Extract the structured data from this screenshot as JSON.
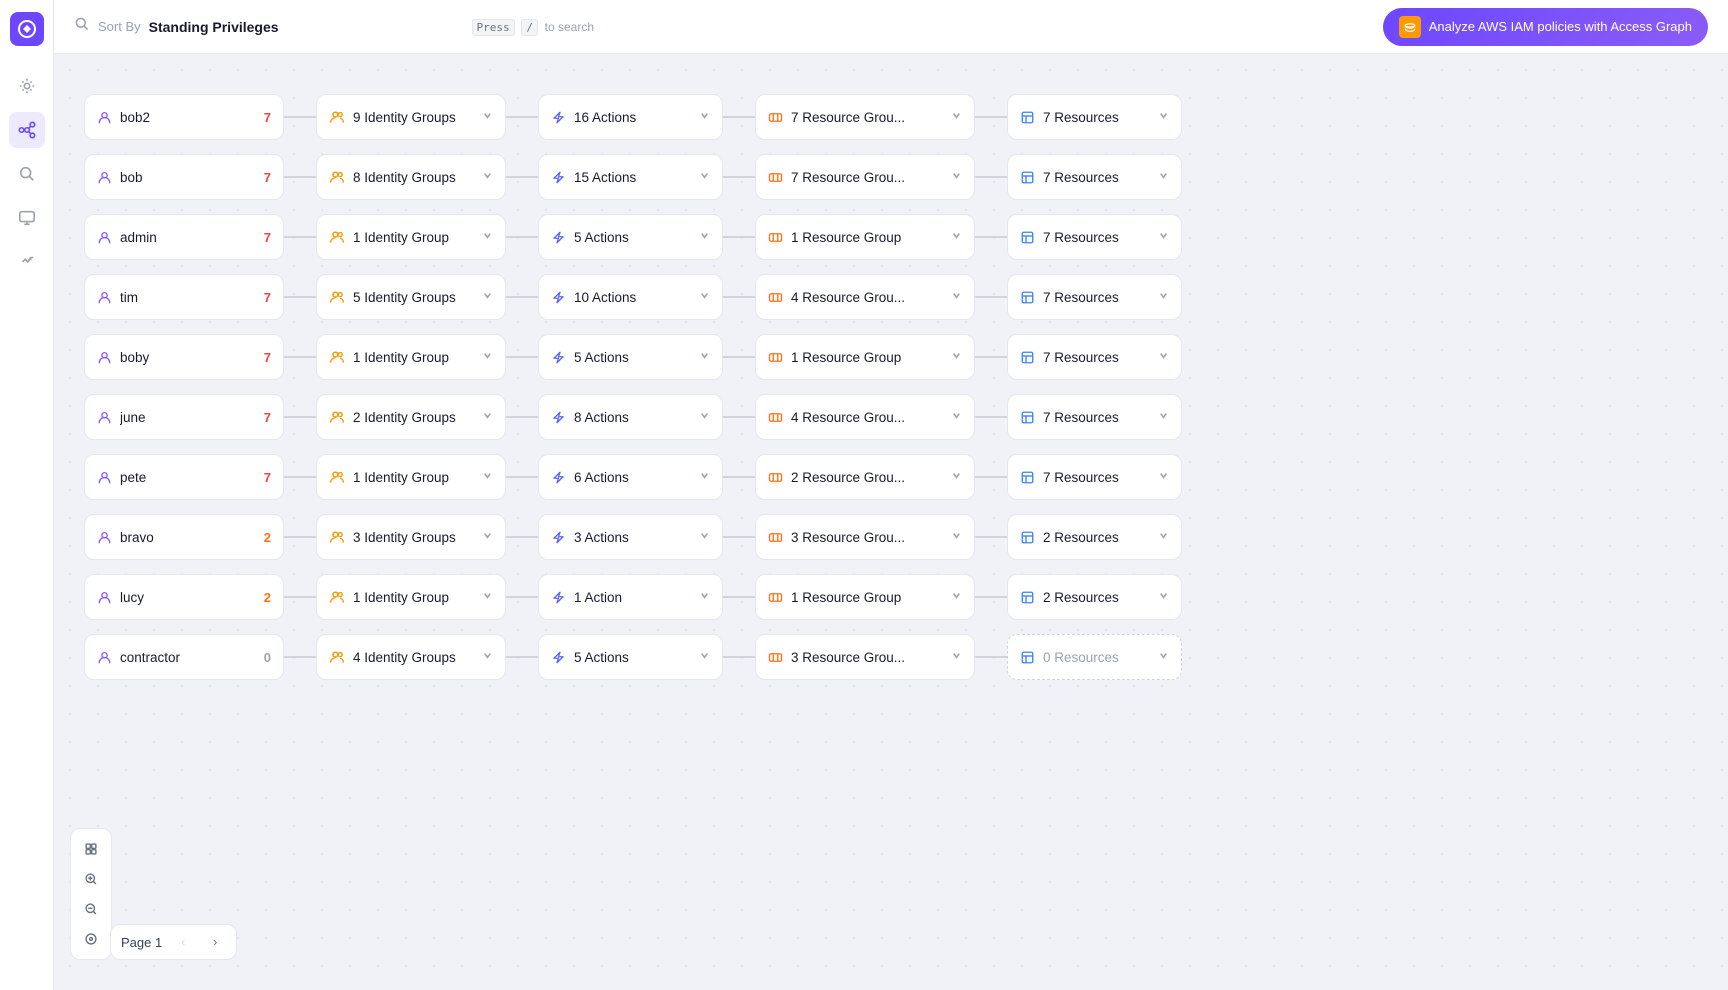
{
  "topbar": {
    "sort_by_label": "Sort By",
    "sort_value": "Standing Privileges",
    "search_hint_press": "Press",
    "search_hint_key": "/",
    "search_hint_text": "to search",
    "aws_btn_label": "Analyze AWS IAM policies with Access Graph",
    "aws_logo_text": "AWS"
  },
  "sidebar": {
    "items": [
      {
        "name": "home",
        "icon": "⚙",
        "active": false
      },
      {
        "name": "graph",
        "icon": "⬡",
        "active": true
      },
      {
        "name": "search",
        "icon": "🔍",
        "active": false
      },
      {
        "name": "monitor",
        "icon": "🖥",
        "active": false
      },
      {
        "name": "integrations",
        "icon": "⚡",
        "active": false
      }
    ]
  },
  "rows": [
    {
      "user": {
        "name": "bob2",
        "count": "7"
      },
      "groups": {
        "label": "9 Identity Groups",
        "count": null
      },
      "actions": {
        "label": "16 Actions",
        "count": null
      },
      "resource_groups": {
        "label": "7 Resource Grou...",
        "count": null
      },
      "resources": {
        "label": "7 Resources",
        "count": null
      }
    },
    {
      "user": {
        "name": "bob",
        "count": "7"
      },
      "groups": {
        "label": "8 Identity Groups",
        "count": null
      },
      "actions": {
        "label": "15 Actions",
        "count": null
      },
      "resource_groups": {
        "label": "7 Resource Grou...",
        "count": null
      },
      "resources": {
        "label": "7 Resources",
        "count": null
      }
    },
    {
      "user": {
        "name": "admin",
        "count": "7"
      },
      "groups": {
        "label": "1 Identity Group",
        "count": null
      },
      "actions": {
        "label": "5 Actions",
        "count": null
      },
      "resource_groups": {
        "label": "1 Resource Group",
        "count": null
      },
      "resources": {
        "label": "7 Resources",
        "count": null
      }
    },
    {
      "user": {
        "name": "tim",
        "count": "7"
      },
      "groups": {
        "label": "5 Identity Groups",
        "count": null
      },
      "actions": {
        "label": "10 Actions",
        "count": null
      },
      "resource_groups": {
        "label": "4 Resource Grou...",
        "count": null
      },
      "resources": {
        "label": "7 Resources",
        "count": null
      }
    },
    {
      "user": {
        "name": "boby",
        "count": "7"
      },
      "groups": {
        "label": "1 Identity Group",
        "count": null
      },
      "actions": {
        "label": "5 Actions",
        "count": null
      },
      "resource_groups": {
        "label": "1 Resource Group",
        "count": null
      },
      "resources": {
        "label": "7 Resources",
        "count": null
      }
    },
    {
      "user": {
        "name": "june",
        "count": "7"
      },
      "groups": {
        "label": "2 Identity Groups",
        "count": null
      },
      "actions": {
        "label": "8 Actions",
        "count": null
      },
      "resource_groups": {
        "label": "4 Resource Grou...",
        "count": null
      },
      "resources": {
        "label": "7 Resources",
        "count": null
      }
    },
    {
      "user": {
        "name": "pete",
        "count": "7"
      },
      "groups": {
        "label": "1 Identity Group",
        "count": null
      },
      "actions": {
        "label": "6 Actions",
        "count": null
      },
      "resource_groups": {
        "label": "2 Resource Grou...",
        "count": null
      },
      "resources": {
        "label": "7 Resources",
        "count": null
      }
    },
    {
      "user": {
        "name": "bravo",
        "count": "2",
        "count_type": "low"
      },
      "groups": {
        "label": "3 Identity Groups",
        "count": null
      },
      "actions": {
        "label": "3 Actions",
        "count": null
      },
      "resource_groups": {
        "label": "3 Resource Grou...",
        "count": null
      },
      "resources": {
        "label": "2 Resources",
        "count": null
      }
    },
    {
      "user": {
        "name": "lucy",
        "count": "2",
        "count_type": "low"
      },
      "groups": {
        "label": "1 Identity Group",
        "count": null
      },
      "actions": {
        "label": "1 Action",
        "count": null
      },
      "resource_groups": {
        "label": "1 Resource Group",
        "count": null
      },
      "resources": {
        "label": "2 Resources",
        "count": null
      }
    },
    {
      "user": {
        "name": "contractor",
        "count": "0",
        "count_type": "zero"
      },
      "groups": {
        "label": "4 Identity Groups",
        "count": null
      },
      "actions": {
        "label": "5 Actions",
        "count": null
      },
      "resource_groups": {
        "label": "3 Resource Grou...",
        "count": null
      },
      "resources": {
        "label": "0 Resources",
        "count": null,
        "dashed": true
      }
    }
  ],
  "pagination": {
    "page_label": "Page 1"
  },
  "toolbar": {
    "buttons": [
      "⊕",
      "+",
      "−",
      "⊙"
    ]
  }
}
